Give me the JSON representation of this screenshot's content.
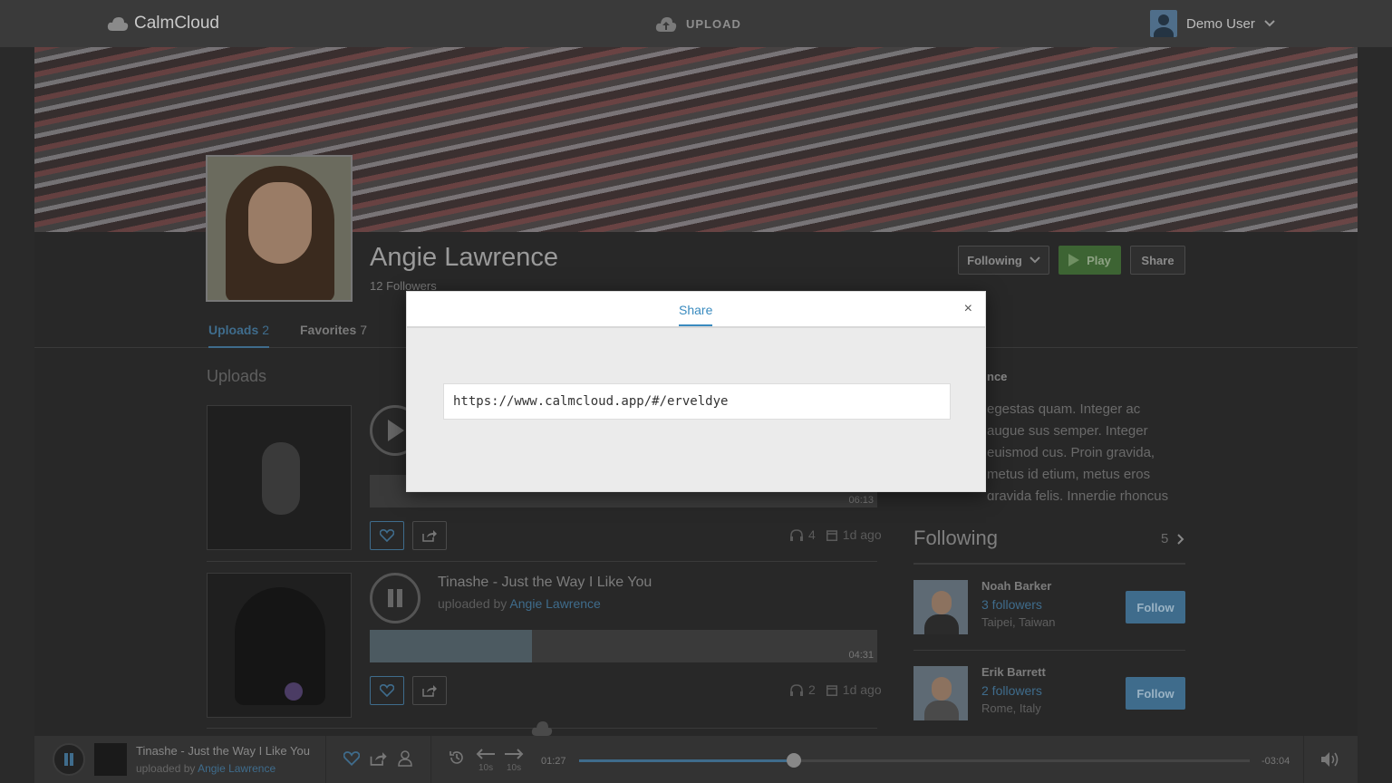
{
  "header": {
    "logo_text": "CalmCloud",
    "upload_label": "UPLOAD",
    "user_name": "Demo User"
  },
  "profile": {
    "name": "Angie Lawrence",
    "followers": "12 Followers",
    "following_button": "Following",
    "play_button": "Play",
    "share_button": "Share"
  },
  "tabs": [
    {
      "label": "Uploads",
      "count": "2"
    },
    {
      "label": "Favorites",
      "count": "7"
    }
  ],
  "uploads_section_title": "Uploads",
  "about": {
    "title_fragment": "nce",
    "text": "egestas quam. Integer ac augue sus semper. Integer euismod cus. Proin gravida, metus id etium, metus eros gravida felis, Innerdie rhoncus ligula tellus non mi"
  },
  "tracks": [
    {
      "duration": "06:13",
      "plays": "4",
      "age": "1d ago",
      "progress": 0
    },
    {
      "title": "Tinashe - Just the Way I Like You",
      "uploaded_by_prefix": "uploaded by",
      "uploader": "Angie Lawrence",
      "duration": "04:31",
      "plays": "2",
      "age": "1d ago",
      "progress": 0.32
    }
  ],
  "following": {
    "title": "Following",
    "count": "5",
    "people": [
      {
        "name": "Noah Barker",
        "followers": "3 followers",
        "location": "Taipei, Taiwan",
        "follow_label": "Follow"
      },
      {
        "name": "Erik Barrett",
        "followers": "2 followers",
        "location": "Rome, Italy",
        "follow_label": "Follow"
      }
    ]
  },
  "player": {
    "title": "Tinashe - Just the Way I Like You",
    "uploaded_by_prefix": "uploaded by",
    "uploader": "Angie Lawrence",
    "elapsed": "01:27",
    "remaining": "-03:04",
    "skip_back_label": "10s",
    "skip_forward_label": "10s",
    "progress": 0.32
  },
  "modal": {
    "tab_label": "Share",
    "close_label": "×",
    "share_url": "https://www.calmcloud.app/#/erveldye"
  },
  "colors": {
    "accent": "#3a8bbf",
    "play_green": "#3d6433",
    "follow_blue": "#3f6c8c"
  }
}
